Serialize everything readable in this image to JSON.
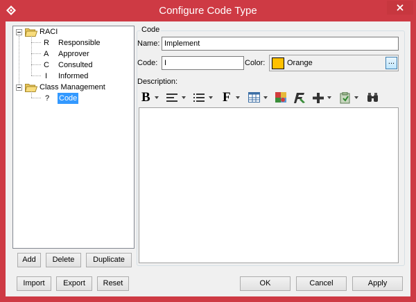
{
  "window": {
    "title": "Configure Code Type",
    "app_icon": "visual-paradigm-logo-icon",
    "close_icon": "close-icon",
    "accent_color": "#ce3a44"
  },
  "tree": {
    "groups": [
      {
        "label": "RACI",
        "icon": "folder-open-icon",
        "items": [
          {
            "code": "R",
            "label": "Responsible"
          },
          {
            "code": "A",
            "label": "Approver"
          },
          {
            "code": "C",
            "label": "Consulted"
          },
          {
            "code": "I",
            "label": "Informed"
          }
        ]
      },
      {
        "label": "Class Management",
        "icon": "folder-open-icon",
        "items": [
          {
            "code": "?",
            "label": "Code",
            "selected": true
          }
        ]
      }
    ]
  },
  "tree_buttons": {
    "add": "Add",
    "delete": "Delete",
    "duplicate": "Duplicate"
  },
  "bottom_buttons": {
    "import": "Import",
    "export": "Export",
    "reset": "Reset",
    "ok": "OK",
    "cancel": "Cancel",
    "apply": "Apply"
  },
  "code_group": {
    "title": "Code",
    "name_label": "Name:",
    "name_value": "Implement",
    "code_label": "Code:",
    "code_value": "I",
    "color_label": "Color:",
    "color_name": "Orange",
    "color_hex": "#ffc000",
    "color_button": "...",
    "description_label": "Description:"
  },
  "description_toolbar": {
    "bold_glyph": "B",
    "font_glyph": "F",
    "icons": [
      "bold-icon",
      "align-icon",
      "list-icon",
      "font-icon",
      "table-icon",
      "image-icon",
      "format-icon",
      "insert-icon",
      "paste-icon",
      "find-icon"
    ]
  }
}
